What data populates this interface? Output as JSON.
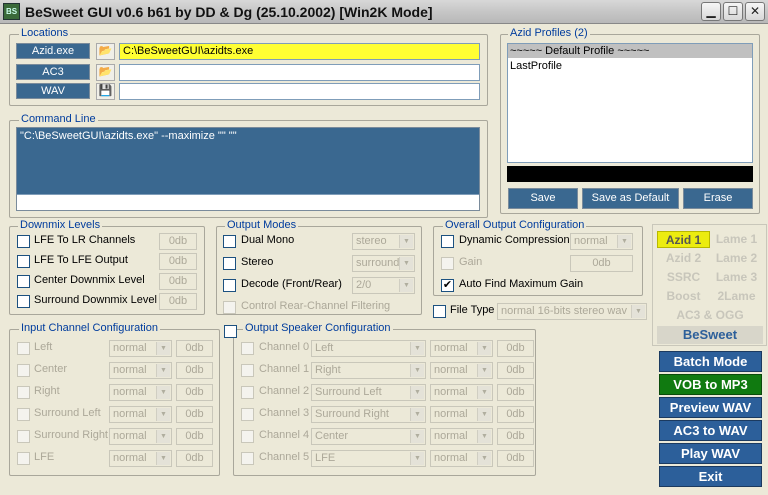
{
  "window": {
    "title": "BeSweet GUI v0.6 b61 by DD & Dg (25.10.2002)  [Win2K Mode]",
    "icon": "besweet-app-icon"
  },
  "locations": {
    "title": "Locations",
    "rows": [
      {
        "label": "Azid.exe",
        "value": "C:\\BeSweetGUI\\azidts.exe",
        "icon": "folder-open-icon"
      },
      {
        "label": "AC3",
        "value": "",
        "icon": "folder-open-icon"
      },
      {
        "label": "WAV",
        "value": "",
        "icon": "save-disk-icon"
      }
    ]
  },
  "command_line": {
    "title": "Command Line",
    "value": "\"C:\\BeSweetGUI\\azidts.exe\" --maximize \"\" \"\""
  },
  "profiles": {
    "title": "Azid Profiles (2)",
    "items": [
      "~~~~~ Default Profile ~~~~~",
      "LastProfile"
    ],
    "selected": 0,
    "buttons": [
      "Save",
      "Save as Default",
      "Erase"
    ]
  },
  "downmix": {
    "title": "Downmix Levels",
    "items": [
      {
        "label": "LFE To LR Channels",
        "value": "0db"
      },
      {
        "label": "LFE To LFE Output",
        "value": "0db"
      },
      {
        "label": "Center Downmix Level",
        "value": "0db"
      },
      {
        "label": "Surround Downmix Level",
        "value": "0db"
      }
    ]
  },
  "output_modes": {
    "title": "Output Modes",
    "items": [
      {
        "label": "Dual Mono",
        "select": "stereo"
      },
      {
        "label": "Stereo",
        "select": "surround"
      },
      {
        "label": "Decode (Front/Rear)",
        "select": "2/0"
      }
    ],
    "rear_filter": "Control Rear-Channel Filtering"
  },
  "overall": {
    "title": "Overall Output Configuration",
    "dynamic": {
      "label": "Dynamic Compression",
      "select": "normal"
    },
    "gain": {
      "label": "Gain",
      "value": "0db"
    },
    "auto_gain": {
      "label": "Auto Find Maximum Gain",
      "checked": true
    },
    "file_type": {
      "label": "File Type",
      "select": "normal 16-bits stereo wav"
    }
  },
  "input_channels": {
    "title": "Input Channel Configuration",
    "rows": [
      {
        "label": "Left",
        "mode": "normal",
        "db": "0db"
      },
      {
        "label": "Center",
        "mode": "normal",
        "db": "0db"
      },
      {
        "label": "Right",
        "mode": "normal",
        "db": "0db"
      },
      {
        "label": "Surround Left",
        "mode": "normal",
        "db": "0db"
      },
      {
        "label": "Surround Right",
        "mode": "normal",
        "db": "0db"
      },
      {
        "label": "LFE",
        "mode": "normal",
        "db": "0db"
      }
    ]
  },
  "speaker_config": {
    "title": "Output Speaker Configuration",
    "rows": [
      {
        "label": "Channel 0",
        "source": "Left",
        "mode": "normal",
        "db": "0db"
      },
      {
        "label": "Channel 1",
        "source": "Right",
        "mode": "normal",
        "db": "0db"
      },
      {
        "label": "Channel 2",
        "source": "Surround Left",
        "mode": "normal",
        "db": "0db"
      },
      {
        "label": "Channel 3",
        "source": "Surround Right",
        "mode": "normal",
        "db": "0db"
      },
      {
        "label": "Channel 4",
        "source": "Center",
        "mode": "normal",
        "db": "0db"
      },
      {
        "label": "Channel 5",
        "source": "LFE",
        "mode": "normal",
        "db": "0db"
      }
    ]
  },
  "tools": {
    "grid": [
      [
        "Azid 1",
        "Lame 1"
      ],
      [
        "Azid 2",
        "Lame 2"
      ],
      [
        "SSRC",
        "Lame 3"
      ],
      [
        "Boost",
        "2Lame"
      ]
    ],
    "ac3ogg": "AC3 & OGG",
    "besweet": "BeSweet",
    "active_color": "#e8e800"
  },
  "actions": [
    {
      "label": "Batch Mode",
      "color": "#2c5f9a"
    },
    {
      "label": "VOB to MP3",
      "color": "#107a10"
    },
    {
      "label": "Preview WAV",
      "color": "#2c5f9a"
    },
    {
      "label": "AC3 to WAV",
      "color": "#2c5f9a"
    },
    {
      "label": "Play WAV",
      "color": "#2c5f9a"
    },
    {
      "label": "Exit",
      "color": "#2c5f9a"
    }
  ]
}
